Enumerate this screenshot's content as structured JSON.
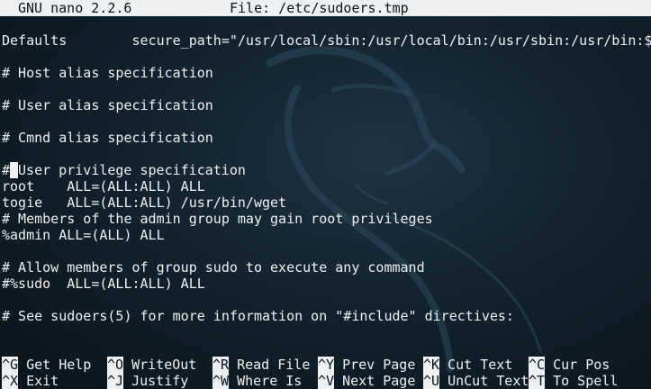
{
  "colors": {
    "background": "#12222e",
    "text": "#eef2f4",
    "inverse_bar": "#eef0f1",
    "inverse_text": "#0a141c"
  },
  "title_bar": {
    "app": "GNU nano 2.2.6",
    "file": "File: /etc/sudoers.tmp"
  },
  "editor": {
    "cursor_line": 9,
    "cursor_char": "#",
    "lines": [
      "Defaults        secure_path=\"/usr/local/sbin:/usr/local/bin:/usr/sbin:/usr/bin:$",
      "",
      "# Host alias specification",
      "",
      "# User alias specification",
      "",
      "# Cmnd alias specification",
      "",
      "",
      "User privilege specification",
      "root    ALL=(ALL:ALL) ALL",
      "togie   ALL=(ALL:ALL) /usr/bin/wget",
      "# Members of the admin group may gain root privileges",
      "%admin ALL=(ALL) ALL",
      "",
      "# Allow members of group sudo to execute any command",
      "#%sudo  ALL=(ALL:ALL) ALL",
      "",
      "# See sudoers(5) for more information on \"#include\" directives:"
    ]
  },
  "shortcuts": {
    "row1": [
      {
        "key": "^G",
        "label": "Get Help"
      },
      {
        "key": "^O",
        "label": "WriteOut"
      },
      {
        "key": "^R",
        "label": "Read File"
      },
      {
        "key": "^Y",
        "label": "Prev Page"
      },
      {
        "key": "^K",
        "label": "Cut Text"
      },
      {
        "key": "^C",
        "label": "Cur Pos"
      }
    ],
    "row2": [
      {
        "key": "^X",
        "label": "Exit"
      },
      {
        "key": "^J",
        "label": "Justify"
      },
      {
        "key": "^W",
        "label": "Where Is"
      },
      {
        "key": "^V",
        "label": "Next Page"
      },
      {
        "key": "^U",
        "label": "UnCut Text"
      },
      {
        "key": "^T",
        "label": "To Spell"
      }
    ]
  }
}
